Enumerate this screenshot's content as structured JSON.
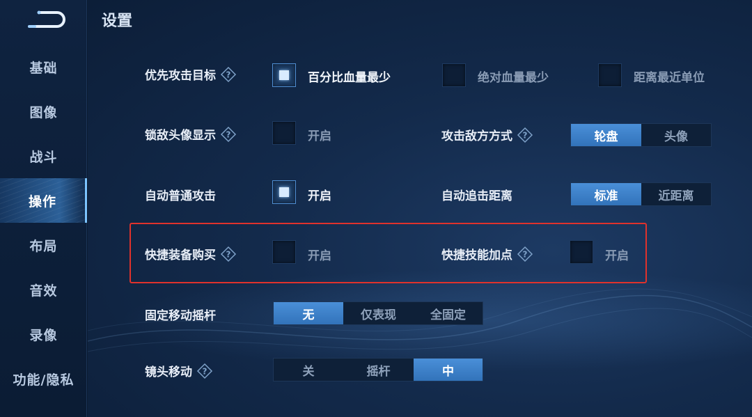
{
  "title": "设置",
  "sidebar": {
    "items": [
      {
        "label": "基础",
        "active": false
      },
      {
        "label": "图像",
        "active": false
      },
      {
        "label": "战斗",
        "active": false
      },
      {
        "label": "操作",
        "active": true
      },
      {
        "label": "布局",
        "active": false
      },
      {
        "label": "音效",
        "active": false
      },
      {
        "label": "录像",
        "active": false
      },
      {
        "label": "功能/隐私",
        "active": false
      }
    ]
  },
  "settings": {
    "priority_target": {
      "label": "优先攻击目标",
      "options": [
        {
          "label": "百分比血量最少",
          "checked": true
        },
        {
          "label": "绝对血量最少",
          "checked": false
        },
        {
          "label": "距离最近单位",
          "checked": false
        }
      ]
    },
    "lock_avatar": {
      "label": "锁敌头像显示",
      "toggle_label": "开启",
      "checked": false
    },
    "attack_mode": {
      "label": "攻击敌方方式",
      "options": [
        "轮盘",
        "头像"
      ],
      "selected": "轮盘"
    },
    "auto_attack": {
      "label": "自动普通攻击",
      "toggle_label": "开启",
      "checked": true
    },
    "chase_distance": {
      "label": "自动追击距离",
      "options": [
        "标准",
        "近距离"
      ],
      "selected": "标准"
    },
    "quick_buy": {
      "label": "快捷装备购买",
      "toggle_label": "开启",
      "checked": false
    },
    "quick_skill": {
      "label": "快捷技能加点",
      "toggle_label": "开启",
      "checked": false
    },
    "fixed_joystick": {
      "label": "固定移动摇杆",
      "options": [
        "无",
        "仅表现",
        "全固定"
      ],
      "selected": "无"
    },
    "camera_move": {
      "label": "镜头移动",
      "options": [
        "关",
        "摇杆",
        "中"
      ],
      "selected": "中"
    }
  },
  "colors": {
    "accent": "#3f84cc",
    "highlight_box": "#e0322c",
    "background": "#132a4b"
  },
  "icons": {
    "back": "back-arrow-icon",
    "help": "question-diamond-icon"
  }
}
